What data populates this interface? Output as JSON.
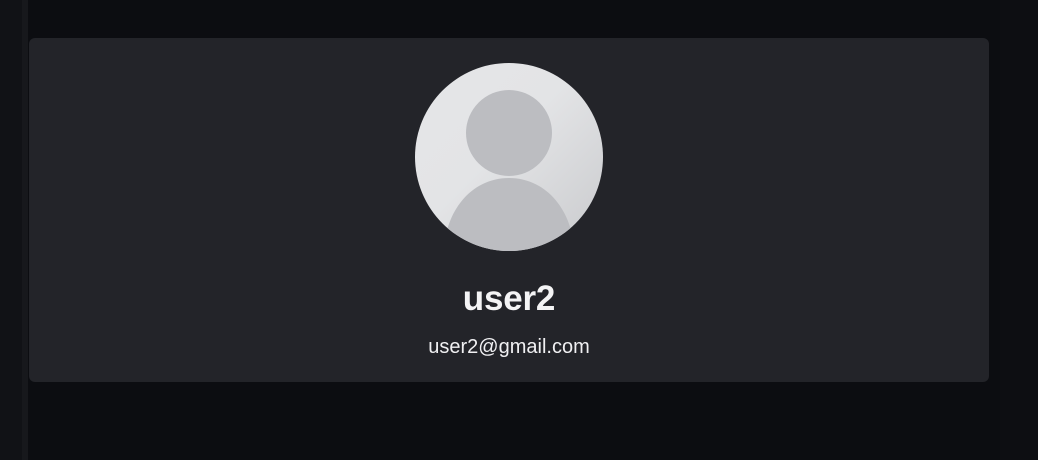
{
  "profile": {
    "name": "user2",
    "email": "user2@gmail.com",
    "avatar_icon": "default-user-avatar-icon"
  },
  "colors": {
    "page_background": "#0c0d11",
    "card_background": "#232429",
    "avatar_background": "#e3e4e6",
    "avatar_silhouette": "#bcbdc1",
    "text_primary": "#f4f4f5"
  }
}
